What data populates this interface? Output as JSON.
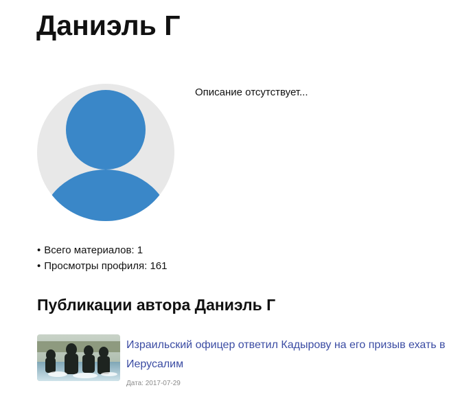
{
  "profile": {
    "name": "Даниэль Г",
    "description": "Описание отсутствует...",
    "avatar_icon": "user-avatar-icon",
    "avatar_bg_color": "#e8e8e8",
    "avatar_fg_color": "#3a87c8"
  },
  "stats": {
    "bullet": "•",
    "materials": "Всего материалов: 1",
    "views": "Просмотры профиля: 161"
  },
  "publications": {
    "heading": "Публикации автора Даниэль Г",
    "items": [
      {
        "title": "Израильский офицер ответил Кадырову на его призыв ехать в Иерусалим",
        "date": "Дата: 2017-07-29",
        "link_color": "#3b4ca3"
      }
    ]
  }
}
